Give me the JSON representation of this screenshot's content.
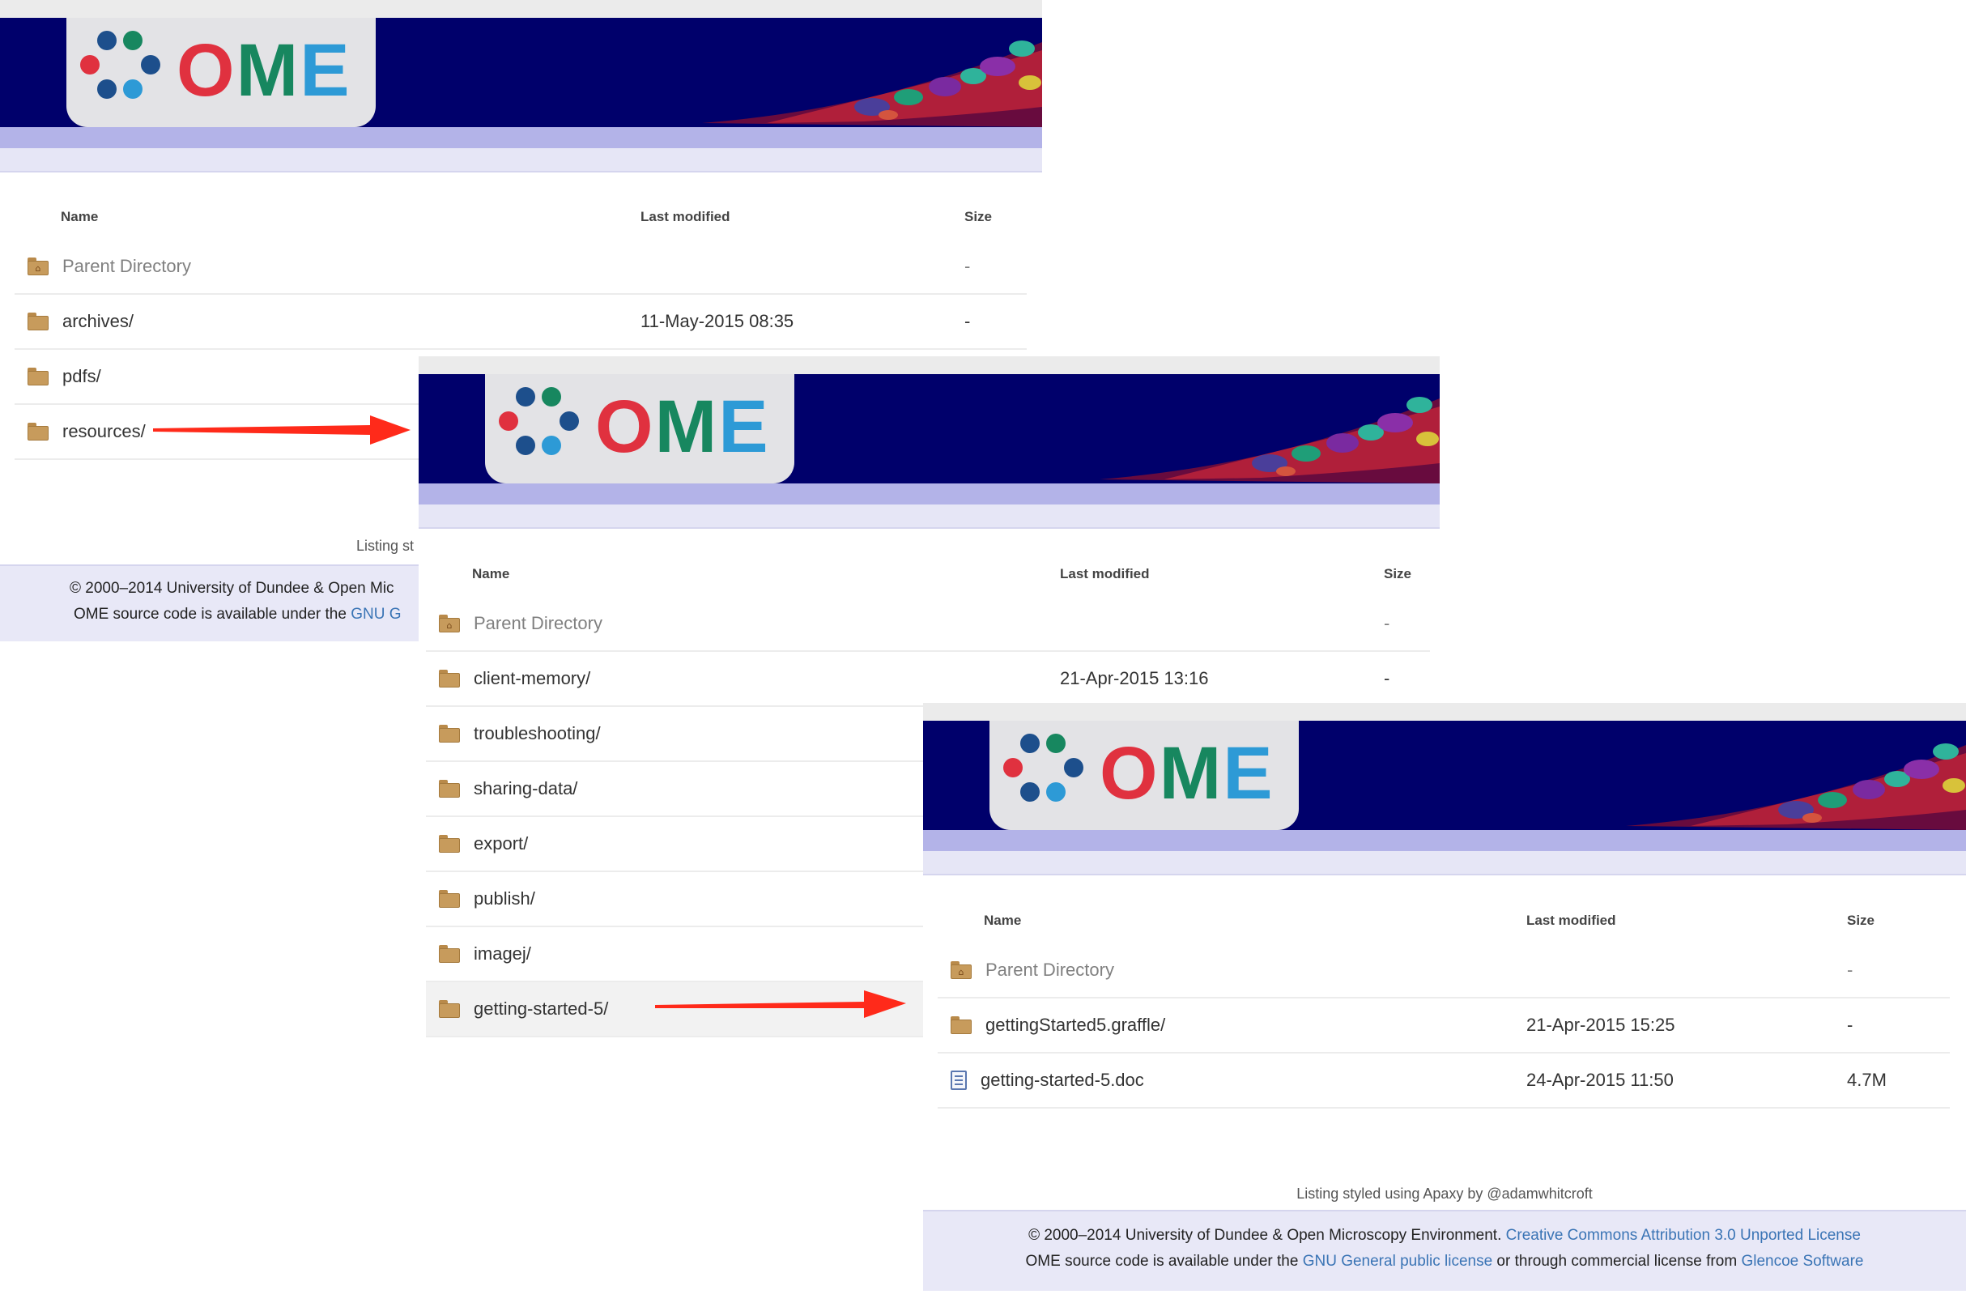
{
  "panels": [
    {
      "id": "p1",
      "logo": {
        "letters": [
          "O",
          "M",
          "E"
        ]
      },
      "columns": {
        "name": "Name",
        "modified": "Last modified",
        "size": "Size"
      },
      "rows": [
        {
          "name": "Parent Directory",
          "modified": "",
          "size": "-",
          "icon": "parent-folder-icon"
        },
        {
          "name": "archives/",
          "modified": "11-May-2015 08:35",
          "size": "-",
          "icon": "folder-icon"
        },
        {
          "name": "pdfs/",
          "modified": "",
          "size": "",
          "icon": "folder-icon"
        },
        {
          "name": "resources/",
          "modified": "",
          "size": "",
          "icon": "folder-icon"
        }
      ],
      "styled_by": "Listing st",
      "footer": {
        "line1": "© 2000–2014 University of Dundee & Open Mic",
        "line2_prefix": "OME source code is available under the ",
        "line2_link": "GNU G"
      }
    },
    {
      "id": "p2",
      "logo": {
        "letters": [
          "O",
          "M",
          "E"
        ]
      },
      "columns": {
        "name": "Name",
        "modified": "Last modified",
        "size": "Size"
      },
      "rows": [
        {
          "name": "Parent Directory",
          "modified": "",
          "size": "-",
          "icon": "parent-folder-icon"
        },
        {
          "name": "client-memory/",
          "modified": "21-Apr-2015 13:16",
          "size": "-",
          "icon": "folder-icon"
        },
        {
          "name": "troubleshooting/",
          "modified": "",
          "size": "",
          "icon": "folder-icon"
        },
        {
          "name": "sharing-data/",
          "modified": "",
          "size": "",
          "icon": "folder-icon"
        },
        {
          "name": "export/",
          "modified": "",
          "size": "",
          "icon": "folder-icon"
        },
        {
          "name": "publish/",
          "modified": "",
          "size": "",
          "icon": "folder-icon"
        },
        {
          "name": "imagej/",
          "modified": "",
          "size": "",
          "icon": "folder-icon"
        },
        {
          "name": "getting-started-5/",
          "modified": "",
          "size": "",
          "icon": "folder-icon",
          "highlight": true
        }
      ]
    },
    {
      "id": "p3",
      "logo": {
        "letters": [
          "O",
          "M",
          "E"
        ]
      },
      "columns": {
        "name": "Name",
        "modified": "Last modified",
        "size": "Size"
      },
      "rows": [
        {
          "name": "Parent Directory",
          "modified": "",
          "size": "-",
          "icon": "parent-folder-icon"
        },
        {
          "name": "gettingStarted5.graffle/",
          "modified": "21-Apr-2015 15:25",
          "size": "-",
          "icon": "folder-icon"
        },
        {
          "name": "getting-started-5.doc",
          "modified": "24-Apr-2015 11:50",
          "size": "4.7M",
          "icon": "document-icon"
        }
      ],
      "styled_by": "Listing styled using Apaxy by @adamwhitcroft",
      "footer": {
        "line1_prefix": "© 2000–2014 University of Dundee & Open Microscopy Environment. ",
        "line1_link": "Creative Commons Attribution 3.0 Unported License",
        "line2_prefix": "OME source code is available under the ",
        "line2_link1": "GNU General public license",
        "line2_middle": " or through commercial license from ",
        "line2_link2": "Glencoe Software"
      }
    }
  ],
  "colors": {
    "banner": "#00006b",
    "band_dark": "#b3b3e8",
    "band_light": "#e6e6f6",
    "logo_red": "#e0313f",
    "logo_green": "#17875f",
    "logo_blue": "#2d9ad6",
    "logo_navy": "#1d4f8c",
    "link": "#3a74b5",
    "arrow": "#ff2a1a"
  }
}
